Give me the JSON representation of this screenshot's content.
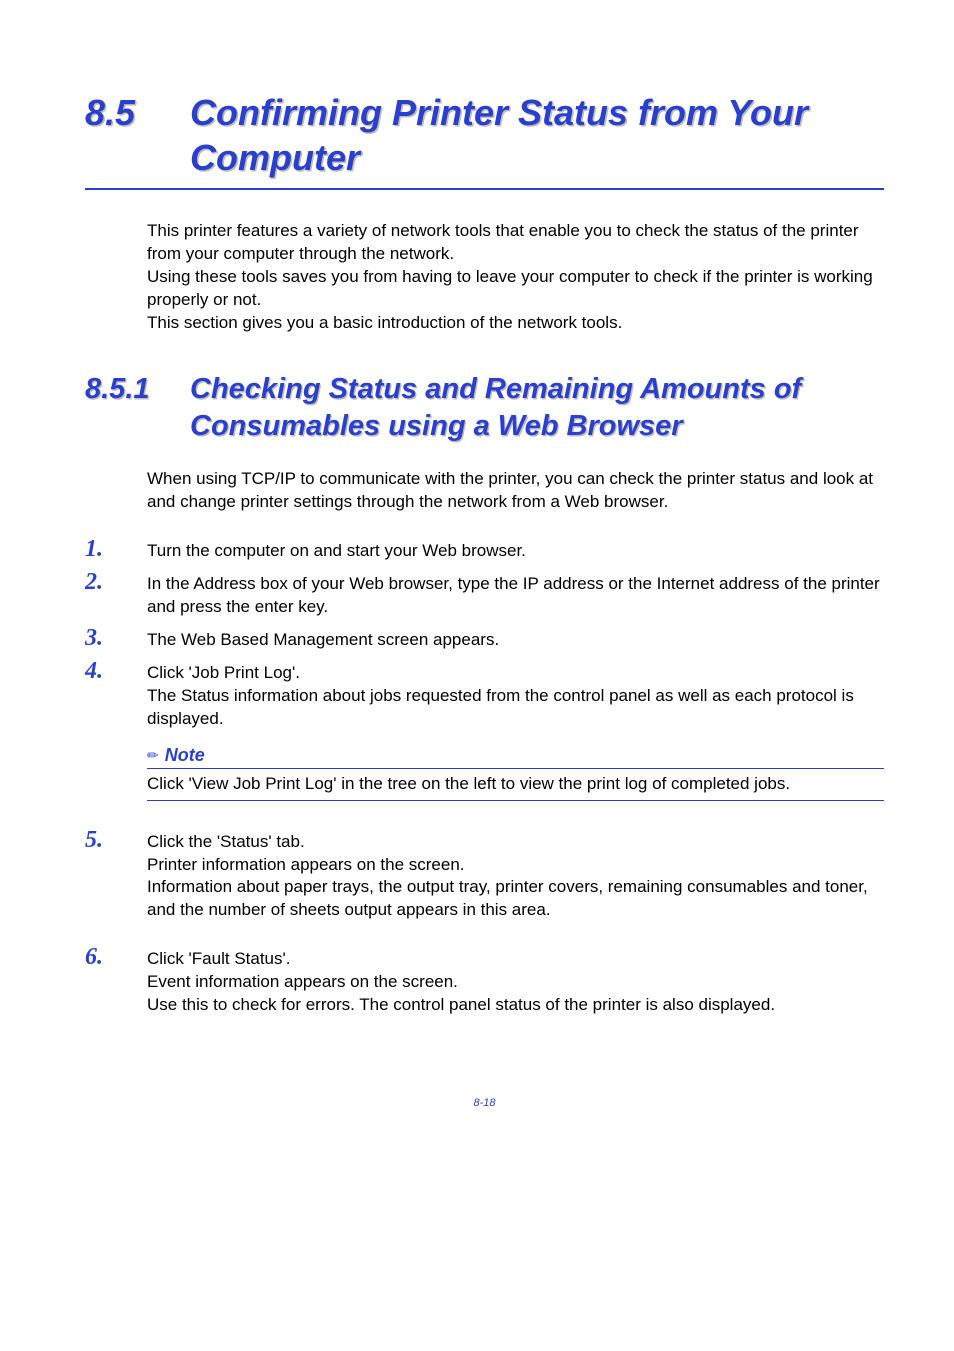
{
  "mainTitle": {
    "number": "8.5",
    "text": "Confirming Printer Status from Your Computer"
  },
  "intro": "This printer features a variety of network tools that enable you to check the status of the printer from your computer through the network.\nUsing these tools saves you from having to leave your computer to check if the printer is working properly or not.\nThis section gives you a basic introduction of the network tools.",
  "subTitle": {
    "number": "8.5.1",
    "text": "Checking Status and Remaining Amounts of Consumables using a Web Browser"
  },
  "intro2": "When using TCP/IP to communicate with the printer, you can check the printer status and look at and change printer settings through the network from a Web browser.",
  "steps": [
    {
      "n": "1.",
      "body": "Turn the computer on and start your Web browser."
    },
    {
      "n": "2.",
      "body": "In the Address box of your Web browser, type the IP address or the Internet address of the printer and press the enter key."
    },
    {
      "n": "3.",
      "body": "The Web Based Management screen appears."
    },
    {
      "n": "4.",
      "body": "Click 'Job Print Log'.\nThe Status information about jobs requested from the control panel as well as each protocol is displayed."
    }
  ],
  "note": {
    "label": "Note",
    "body": "Click 'View Job Print Log' in the tree on the left to view the print log of completed jobs."
  },
  "step5": {
    "n": "5.",
    "body": "Click the 'Status' tab.\nPrinter information appears on the screen.\nInformation about paper trays, the output tray, printer covers, remaining consumables and toner, and the number of sheets output appears in this area."
  },
  "step6": {
    "n": "6.",
    "body": "Click 'Fault Status'.\nEvent information appears on the screen.\nUse this to check for errors. The control panel status of the printer is also displayed."
  },
  "pageNumber": "8-18"
}
